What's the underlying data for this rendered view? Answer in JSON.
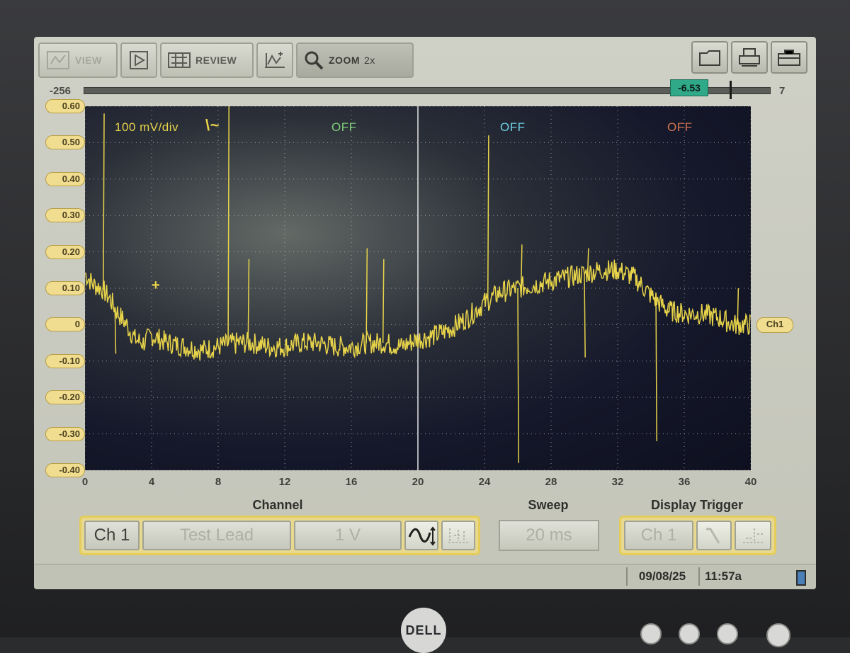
{
  "toolbar": {
    "view_label": "VIEW",
    "play_label": "",
    "review_label": "REVIEW",
    "zoom_label": "ZOOM",
    "zoom_level": "2x"
  },
  "scrollbar": {
    "min": "-256",
    "max": "7",
    "readout": "-6.53"
  },
  "scope": {
    "volts_per_div": "100 mV/div",
    "trigger_symbol": "\\~",
    "channel_states": [
      "OFF",
      "OFF",
      "OFF"
    ],
    "channel_state_colors": [
      "#7fd07a",
      "#6fd3e6",
      "#d4744e"
    ],
    "trace_color": "#e8d44a",
    "channel_marker": "Ch1",
    "cursor_symbol": "+"
  },
  "chart_data": {
    "type": "line",
    "xlim": [
      0,
      40
    ],
    "ylim": [
      -0.4,
      0.6
    ],
    "xticks": [
      "0",
      "4",
      "8",
      "12",
      "16",
      "20",
      "24",
      "28",
      "32",
      "36",
      "40"
    ],
    "yticks": [
      "0.60",
      "0.50",
      "0.40",
      "0.30",
      "0.20",
      "0.10",
      "0",
      "-0.10",
      "-0.20",
      "-0.30",
      "-0.40"
    ],
    "grid": true,
    "series": [
      {
        "x": [
          0,
          0.5,
          1,
          1.5,
          2,
          2.5,
          3,
          3.5,
          4,
          5,
          6,
          7,
          8,
          9,
          10,
          11,
          12,
          13,
          14,
          15,
          16,
          17,
          18,
          19,
          20,
          21,
          22,
          23,
          24,
          25,
          26,
          27,
          28,
          29,
          30,
          31,
          32,
          33,
          34,
          35,
          36,
          37,
          38,
          39,
          40
        ],
        "y": [
          0.14,
          0.11,
          0.1,
          0.07,
          0.03,
          0.0,
          -0.04,
          -0.05,
          -0.03,
          -0.05,
          -0.06,
          -0.07,
          -0.06,
          -0.05,
          -0.05,
          -0.06,
          -0.06,
          -0.05,
          -0.05,
          -0.06,
          -0.06,
          -0.05,
          -0.05,
          -0.06,
          -0.04,
          -0.03,
          -0.01,
          0.02,
          0.06,
          0.09,
          0.1,
          0.11,
          0.12,
          0.13,
          0.14,
          0.15,
          0.15,
          0.13,
          0.08,
          0.04,
          0.03,
          0.03,
          0.02,
          0.0,
          0.0
        ]
      }
    ],
    "spikes": [
      {
        "x": 1.1,
        "y": 0.58
      },
      {
        "x": 1.8,
        "y": -0.08
      },
      {
        "x": 8.6,
        "y": 0.62
      },
      {
        "x": 9.0,
        "y": -0.08
      },
      {
        "x": 9.8,
        "y": 0.18
      },
      {
        "x": 16.9,
        "y": 0.21
      },
      {
        "x": 17.9,
        "y": 0.18
      },
      {
        "x": 24.2,
        "y": 0.52
      },
      {
        "x": 26.2,
        "y": 0.22
      },
      {
        "x": 26.0,
        "y": -0.38
      },
      {
        "x": 30.2,
        "y": 0.21
      },
      {
        "x": 30.0,
        "y": -0.09
      },
      {
        "x": 34.3,
        "y": -0.32
      },
      {
        "x": 35.0,
        "y": 0.06
      },
      {
        "x": 39.2,
        "y": 0.1
      }
    ]
  },
  "channel_panel": {
    "title": "Channel",
    "channel": "Ch 1",
    "probe": "Test Lead",
    "range": "1 V"
  },
  "sweep_panel": {
    "title": "Sweep",
    "value": "20 ms"
  },
  "trigger_panel": {
    "title": "Display Trigger",
    "source": "Ch 1"
  },
  "status": {
    "date": "09/08/25",
    "time": "11:57a"
  },
  "brand": "DELL"
}
